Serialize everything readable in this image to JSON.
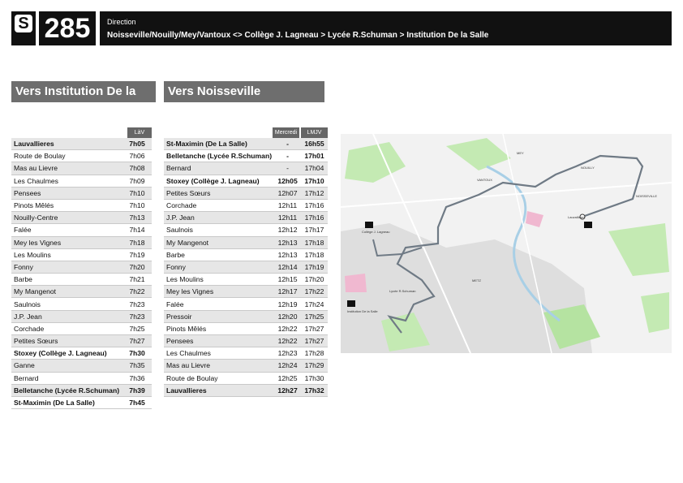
{
  "header": {
    "mode_badge": "S",
    "line_number": "285",
    "direction_label": "Direction",
    "route": "Noisseville/Nouilly/Mey/Vantoux <> Collège J. Lagneau > Lycée R.Schuman > Institution De la Salle"
  },
  "tabs": {
    "outbound": "Vers Institution De la Salle",
    "inbound": "Vers Noisseville"
  },
  "outbound": {
    "col_header": "LàV",
    "stops": [
      {
        "name": "Lauvallieres",
        "time": "7h05",
        "bold": true
      },
      {
        "name": "Route de Boulay",
        "time": "7h06"
      },
      {
        "name": "Mas au Lievre",
        "time": "7h08"
      },
      {
        "name": "Les Chaulmes",
        "time": "7h09"
      },
      {
        "name": "Pensees",
        "time": "7h10"
      },
      {
        "name": "Pinots Mêlés",
        "time": "7h10"
      },
      {
        "name": "Nouilly-Centre",
        "time": "7h13"
      },
      {
        "name": "Falée",
        "time": "7h14"
      },
      {
        "name": "Mey les Vignes",
        "time": "7h18"
      },
      {
        "name": "Les Moulins",
        "time": "7h19"
      },
      {
        "name": "Fonny",
        "time": "7h20"
      },
      {
        "name": "Barbe",
        "time": "7h21"
      },
      {
        "name": "My Mangenot",
        "time": "7h22"
      },
      {
        "name": "Saulnois",
        "time": "7h23"
      },
      {
        "name": "J.P. Jean",
        "time": "7h23"
      },
      {
        "name": "Corchade",
        "time": "7h25"
      },
      {
        "name": "Petites Sœurs",
        "time": "7h27"
      },
      {
        "name": "Stoxey (Collège J. Lagneau)",
        "time": "7h30",
        "bold": true
      },
      {
        "name": "Ganne",
        "time": "7h35"
      },
      {
        "name": "Bernard",
        "time": "7h36"
      },
      {
        "name": "Belletanche (Lycée R.Schuman)",
        "time": "7h39",
        "bold": true
      },
      {
        "name": "St-Maximin (De La Salle)",
        "time": "7h45",
        "bold": true
      }
    ]
  },
  "inbound": {
    "col_headers": [
      "Mercredi",
      "LMJV"
    ],
    "stops": [
      {
        "name": "St-Maximin (De La Salle)",
        "wed": "-",
        "lmjv": "16h55",
        "bold": true
      },
      {
        "name": "Belletanche (Lycée R.Schuman)",
        "wed": "-",
        "lmjv": "17h01",
        "bold": true
      },
      {
        "name": "Bernard",
        "wed": "-",
        "lmjv": "17h04"
      },
      {
        "name": "Stoxey (Collège J. Lagneau)",
        "wed": "12h05",
        "lmjv": "17h10",
        "bold": true
      },
      {
        "name": "Petites Sœurs",
        "wed": "12h07",
        "lmjv": "17h12"
      },
      {
        "name": "Corchade",
        "wed": "12h11",
        "lmjv": "17h16"
      },
      {
        "name": "J.P. Jean",
        "wed": "12h11",
        "lmjv": "17h16"
      },
      {
        "name": "Saulnois",
        "wed": "12h12",
        "lmjv": "17h17"
      },
      {
        "name": "My Mangenot",
        "wed": "12h13",
        "lmjv": "17h18"
      },
      {
        "name": "Barbe",
        "wed": "12h13",
        "lmjv": "17h18"
      },
      {
        "name": "Fonny",
        "wed": "12h14",
        "lmjv": "17h19"
      },
      {
        "name": "Les Moulins",
        "wed": "12h15",
        "lmjv": "17h20"
      },
      {
        "name": "Mey les Vignes",
        "wed": "12h17",
        "lmjv": "17h22"
      },
      {
        "name": "Falée",
        "wed": "12h19",
        "lmjv": "17h24"
      },
      {
        "name": "Pressoir",
        "wed": "12h20",
        "lmjv": "17h25"
      },
      {
        "name": "Pinots Mêlés",
        "wed": "12h22",
        "lmjv": "17h27"
      },
      {
        "name": "Pensees",
        "wed": "12h22",
        "lmjv": "17h27"
      },
      {
        "name": "Les Chaulmes",
        "wed": "12h23",
        "lmjv": "17h28"
      },
      {
        "name": "Mas au Lievre",
        "wed": "12h24",
        "lmjv": "17h29"
      },
      {
        "name": "Route de Boulay",
        "wed": "12h25",
        "lmjv": "17h30"
      },
      {
        "name": "Lauvallieres",
        "wed": "12h27",
        "lmjv": "17h32",
        "bold": true
      }
    ]
  },
  "map": {
    "labels": [
      "MEY",
      "NOUILLY",
      "VANTOUX",
      "NOISSEVILLE",
      "METZ",
      "Lauvallières",
      "Collège J. Lagneau",
      "Lycée R.Schuman",
      "Institution De la Salle"
    ],
    "route_color": "#6f7a85",
    "park_color": "#b9e6a8",
    "urban_color": "#dcdcdc"
  }
}
